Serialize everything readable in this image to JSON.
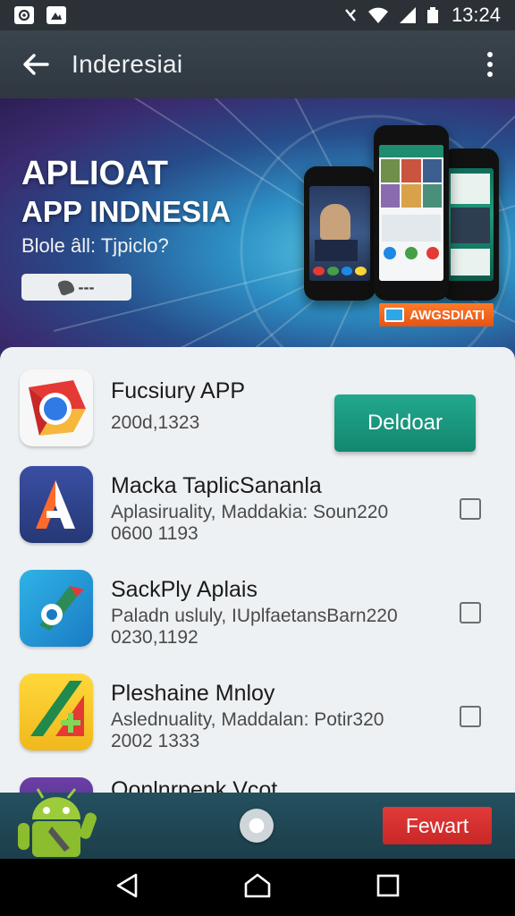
{
  "status_bar": {
    "left_icons": [
      "notification-icon",
      "picture-icon"
    ],
    "right_icons": [
      "vibrate-icon",
      "wifi-icon",
      "signal-icon",
      "battery-icon"
    ],
    "time": "13:24"
  },
  "app_bar": {
    "title": "Inderesiai",
    "back_icon": "arrow-back-icon",
    "menu_icon": "more-vert-icon"
  },
  "banner": {
    "headline_1": "APLIOAT",
    "headline_2": "APP INDNESIA",
    "subtitle": "Blole âll: Tjpiclo?",
    "input_text": "---",
    "badge_text": "AWGSDIATI"
  },
  "featured": {
    "title": "Fucsiury APP",
    "line_1": "200d,1323",
    "button_label": "Deldoar"
  },
  "apps": [
    {
      "title": "Macka TaplicSananla",
      "line_1": "Aplasiruality, Maddakia: Soun220",
      "line_2": "0600 1193",
      "checked": false
    },
    {
      "title": "SackPly Aplais",
      "line_1": "Paladn usluly, IUplfaetansBarn220",
      "line_2": "0230,1192",
      "checked": false
    },
    {
      "title": "Pleshaine Mnloy",
      "line_1": "Aslednuality, Maddalan: Potir320",
      "line_2": "2002 1333",
      "checked": false
    },
    {
      "title": "Oonlnrpenk Vcot",
      "line_1": "",
      "line_2": "",
      "checked": false
    }
  ],
  "bottom_bar": {
    "forward_label": "Fewart"
  },
  "colors": {
    "app_bar": "#333d45",
    "accent_teal": "#14937a",
    "forward_red": "#d22f2f",
    "bottom_bar": "#1f4653"
  }
}
